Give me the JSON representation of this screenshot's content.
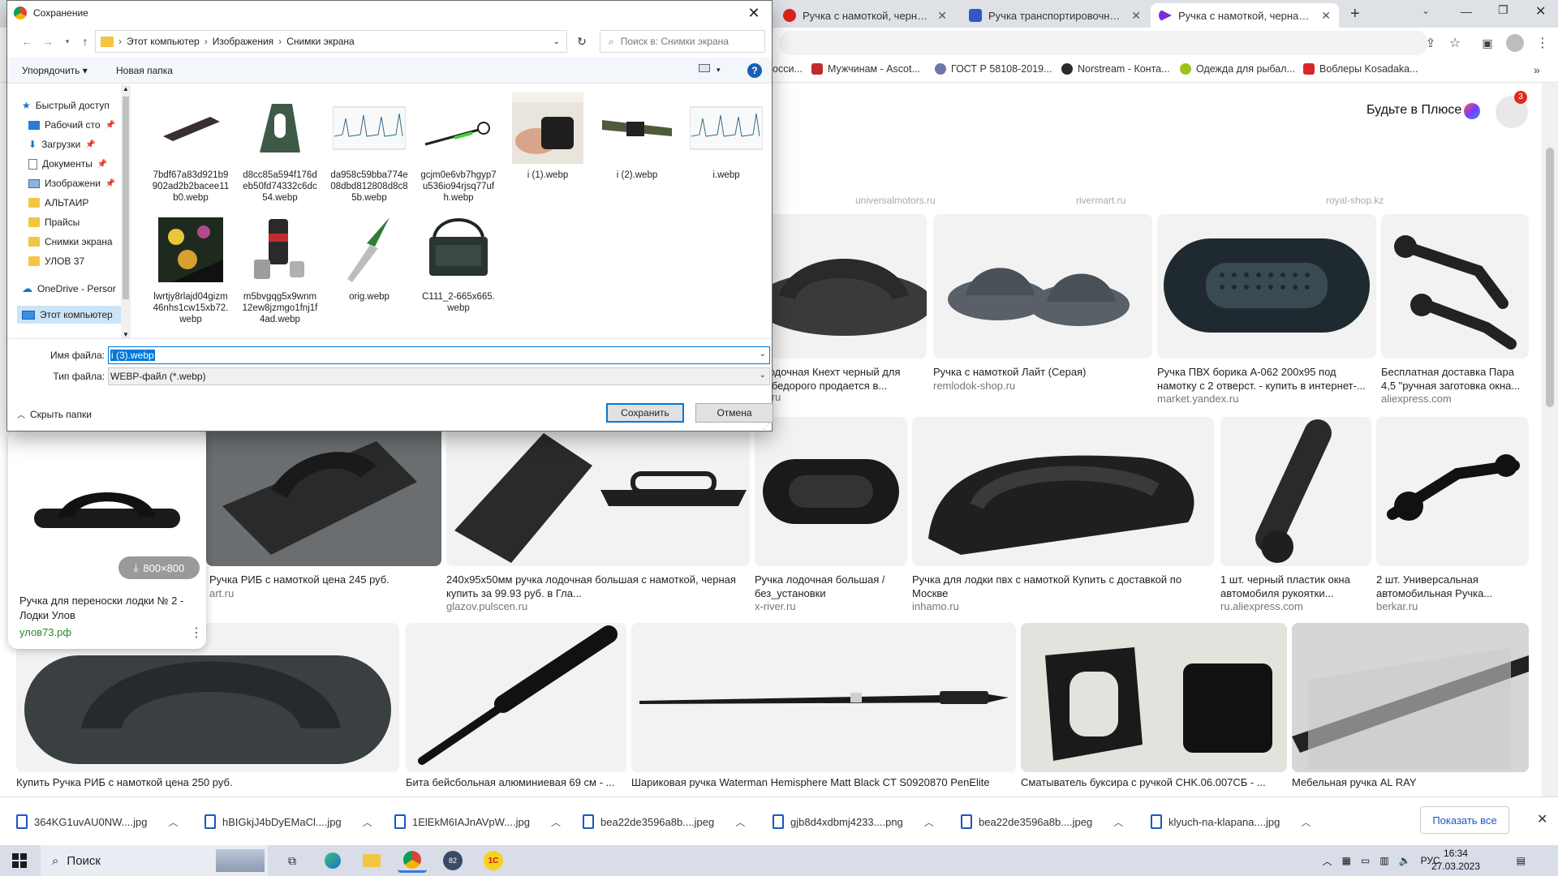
{
  "browser": {
    "tabs": [
      {
        "label": "Ручка с намоткой, черная куп",
        "color": "#d9231d"
      },
      {
        "label": "Ручка транспортировочная с н",
        "color": "#3557c5"
      },
      {
        "label": "Ручка с намоткой, черная (МВ",
        "color": "#7b2ed8"
      }
    ],
    "bookmarks": [
      {
        "label": "осси...",
        "color": "#ffffff"
      },
      {
        "label": "Мужчинам - Ascot...",
        "color": "#c22c2c"
      },
      {
        "label": "ГОСТ Р 58108-2019...",
        "color": "#6c79a8"
      },
      {
        "label": "Norstream - Конта...",
        "color": "#2b2b2b"
      },
      {
        "label": "Одежда для рыбал...",
        "color": "#9bc21a"
      },
      {
        "label": "Воблеры Kosadaka...",
        "color": "#d8262a"
      }
    ]
  },
  "yandex": {
    "plus_label": "Будьте в Плюсе",
    "notification_count": "3"
  },
  "results": {
    "row1_sources": [
      "universalmotors.ru",
      "rivermart.ru",
      "royal-shop.kz"
    ],
    "row1": [
      {
        "caption": "лодочная Кнехт черный для ...бедорого продается в...",
        "source": "...ru"
      },
      {
        "caption": "Ручка с намоткой Лайт (Серая)",
        "source": "remlodok-shop.ru"
      },
      {
        "caption": "Ручка ПВХ борика А-062 200х95 под намотку с 2 отверст. - купить в интернет-...",
        "source": "market.yandex.ru"
      },
      {
        "caption": "Бесплатная доставка Пара 4,5 \"ручная заготовка окна...",
        "source": "aliexpress.com"
      }
    ],
    "row2": [
      {
        "caption": "Ручка РИБ с намоткой цена 245 руб.",
        "source": "art.ru"
      },
      {
        "caption": "240х95х50мм ручка лодочная большая с намоткой, черная купить за 99.93 руб. в Гла...",
        "source": "glazov.pulscen.ru"
      },
      {
        "caption": "Ручка лодочная большая / без_установки",
        "source": "x-river.ru"
      },
      {
        "caption": "Ручка для лодки пвх с намоткой Купить с доставкой по Москве",
        "source": "inhamo.ru"
      },
      {
        "caption": "1 шт. черный пластик окна автомобиля рукоятки...",
        "source": "ru.aliexpress.com"
      },
      {
        "caption": "2 шт. Универсальная автомобильная Ручка...",
        "source": "berkar.ru"
      }
    ],
    "row3": [
      {
        "caption": "Купить Ручка РИБ с намоткой цена 250 руб."
      },
      {
        "caption": "Бита бейсбольная алюминиевая 69 см - ..."
      },
      {
        "caption": "Шариковая ручка Waterman Hemisphere Matt Black CT S0920870 PenElite"
      },
      {
        "caption": "Сматыватель буксира с ручкой CHK.06.007СБ - ..."
      },
      {
        "caption": "Мебельная ручка AL RAY"
      }
    ]
  },
  "preview": {
    "size": "800×800",
    "title": "Ручка для переноски лодки № 2 - Лодки Улов",
    "source": "улов73.рф"
  },
  "downloads": {
    "items": [
      "364KG1uvAU0NW....jpg",
      "hBIGkjJ4bDyEMaCl....jpg",
      "1ElEkM6IAJnAVpW....jpg",
      "bea22de3596a8b....jpeg",
      "gjb8d4xdbmj4233....png",
      "bea22de3596a8b....jpeg",
      "klyuch-na-klapana....jpg"
    ],
    "show_all": "Показать все"
  },
  "taskbar": {
    "search_placeholder": "Поиск",
    "language": "РУС",
    "time": "16:34",
    "date": "27.03.2023",
    "badge": "82"
  },
  "dialog": {
    "title": "Сохранение",
    "path": [
      "Этот компьютер",
      "Изображения",
      "Снимки экрана"
    ],
    "search_placeholder": "Поиск в: Снимки экрана",
    "organize_label": "Упорядочить",
    "new_folder_label": "Новая папка",
    "nav_items": [
      {
        "label": "Быстрый доступ",
        "type": "quick"
      },
      {
        "label": "Рабочий сто",
        "type": "desktop"
      },
      {
        "label": "Загрузки",
        "type": "downloads"
      },
      {
        "label": "Документы",
        "type": "documents"
      },
      {
        "label": "Изображени",
        "type": "pictures"
      },
      {
        "label": "АЛЬТАИР",
        "type": "folder"
      },
      {
        "label": "Прайсы",
        "type": "folder"
      },
      {
        "label": "Снимки экрана",
        "type": "folder"
      },
      {
        "label": "УЛОВ 37",
        "type": "folder"
      },
      {
        "label": "OneDrive - Persor",
        "type": "onedrive"
      },
      {
        "label": "Этот компьютер",
        "type": "pc"
      }
    ],
    "files": [
      "7bdf67a83d921b9902ad2b2bacee11b0.webp",
      "d8cc85a594f176deb50fd74332c6dc54.webp",
      "da958c59bba774e08dbd812808d8c85b.webp",
      "gcjm0e6vb7hgyp7u536io94rjsq77ufh.webp",
      "i (1).webp",
      "i (2).webp",
      "i.webp",
      "lwrtjy8rlajd04gizm46nhs1cw15xb72.webp",
      "m5bvgqg5x9wnm12ew8jzmgo1fnj1f4ad.webp",
      "orig.webp",
      "C111_2-665x665.webp"
    ],
    "filename_label": "Имя файла:",
    "filename_value": "i (3).webp",
    "filetype_label": "Тип файла:",
    "filetype_value": "WEBP-файл (*.webp)",
    "hide_folders_label": "Скрыть папки",
    "save_label": "Сохранить",
    "cancel_label": "Отмена"
  }
}
